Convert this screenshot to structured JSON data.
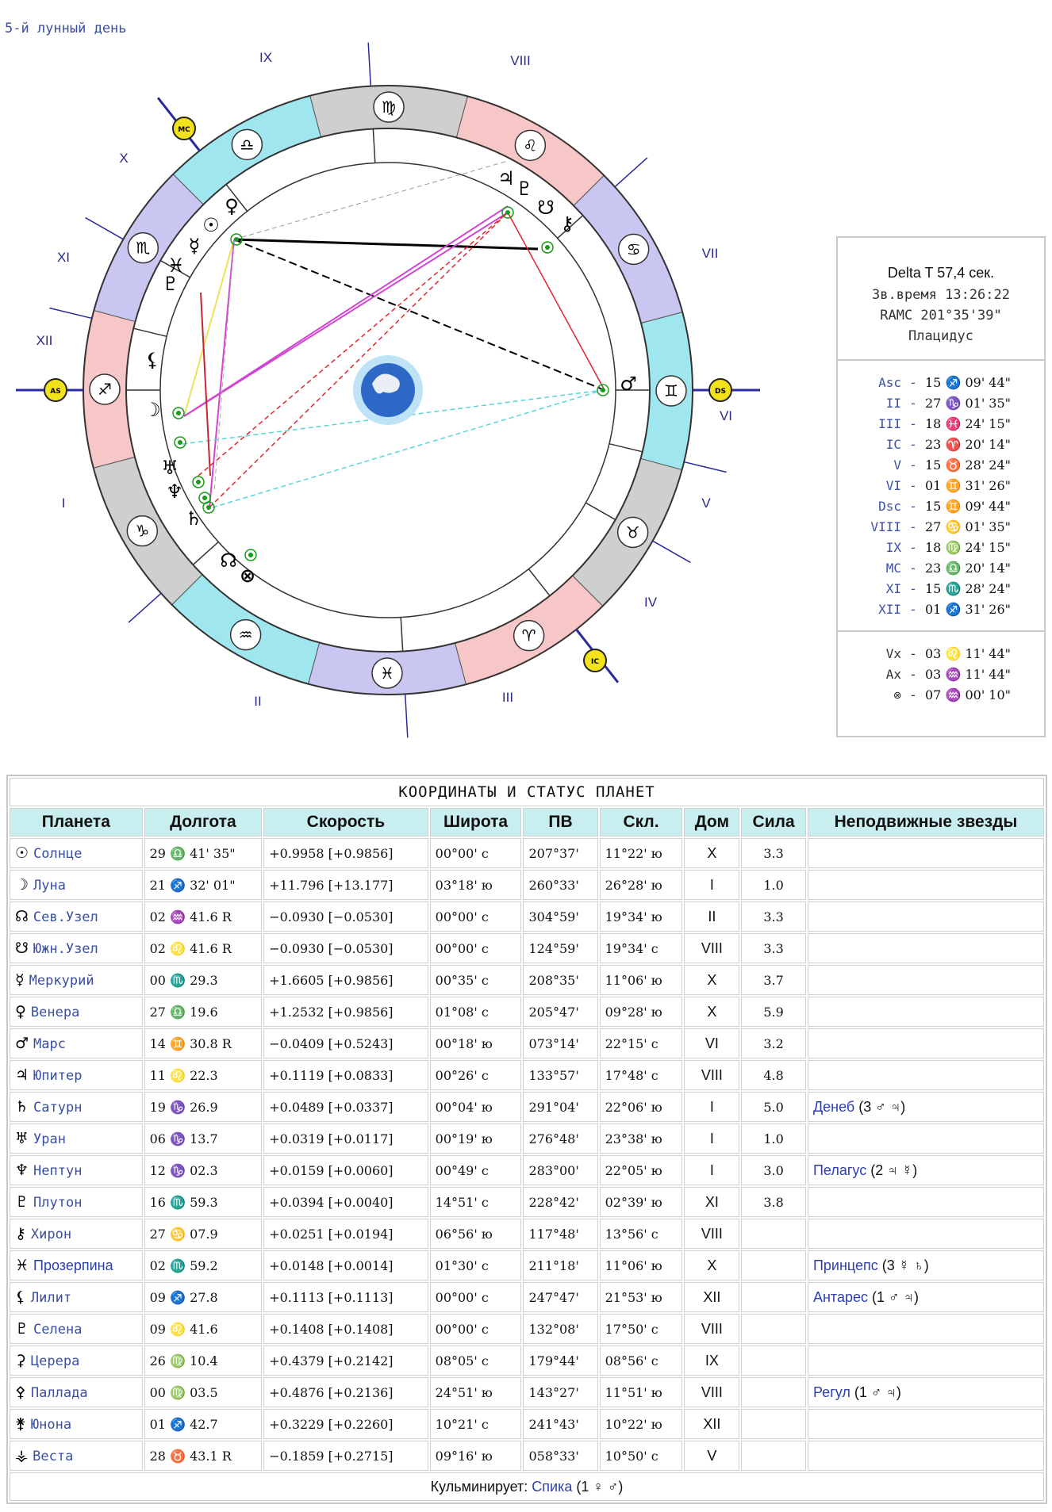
{
  "lunar_day": "5-й лунный день",
  "chart": {
    "house_numerals": [
      "I",
      "II",
      "III",
      "IV",
      "V",
      "VI",
      "VII",
      "VIII",
      "IX",
      "X",
      "XI",
      "XII"
    ],
    "angle_badges": [
      "AS",
      "DS",
      "MC",
      "IC"
    ],
    "sign_glyphs": [
      "♈",
      "♉",
      "♊",
      "♋",
      "♌",
      "♍",
      "♎",
      "♏",
      "♐",
      "♑",
      "♒",
      "♓"
    ],
    "planet_glyphs": {
      "sun": "☉",
      "moon": "☽",
      "mercury": "☿",
      "venus": "♀",
      "mars": "♂",
      "jupiter": "♃",
      "saturn": "♄",
      "uranus": "♅",
      "neptune": "♆",
      "pluto": "♇",
      "chiron": "⚷",
      "north_node": "☊",
      "south_node": "☋",
      "fortune": "⊗",
      "lilith": "⚸",
      "proserpina": "♓"
    }
  },
  "info": {
    "delta_t": "Delta T   57,4 сек.",
    "sidereal": "Зв.время 13:26:22",
    "ramc": "RAMC 201°35'39\"",
    "system": "Плацидус",
    "cusps": [
      {
        "name": "Asc",
        "value": "15 ♐ 09' 44\""
      },
      {
        "name": "II",
        "value": "27 ♑ 01' 35\""
      },
      {
        "name": "III",
        "value": "18 ♓ 24' 15\""
      },
      {
        "name": "IC",
        "value": "23 ♈ 20' 14\""
      },
      {
        "name": "V",
        "value": "15 ♉ 28' 24\""
      },
      {
        "name": "VI",
        "value": "01 ♊ 31' 26\""
      },
      {
        "name": "Dsc",
        "value": "15 ♊ 09' 44\""
      },
      {
        "name": "VIII",
        "value": "27 ♋ 01' 35\""
      },
      {
        "name": "IX",
        "value": "18 ♍ 24' 15\""
      },
      {
        "name": "MC",
        "value": "23 ♎ 20' 14\""
      },
      {
        "name": "XI",
        "value": "15 ♏ 28' 24\""
      },
      {
        "name": "XII",
        "value": "01 ♐ 31' 26\""
      }
    ],
    "extra": [
      {
        "name": "Vx",
        "value": "03 ♌ 11' 44\""
      },
      {
        "name": "Ax",
        "value": "03 ♒ 11' 44\""
      },
      {
        "name": "⊗",
        "value": "07 ♒ 00' 10\""
      }
    ]
  },
  "table": {
    "title": "КООРДИНАТЫ И СТАТУС ПЛАНЕТ",
    "headers": [
      "Планета",
      "Долгота",
      "Скорость",
      "Широта",
      "ПВ",
      "Скл.",
      "Дом",
      "Сила",
      "Неподвижные звезды"
    ],
    "rows": [
      {
        "glyph": "☉",
        "name": "Солнце",
        "lon": "29 ♎ 41' 35\"",
        "speed": "+0.9958  [+0.9856]",
        "lat": "00°00' с",
        "ra": "207°37'",
        "decl": "11°22' ю",
        "house": "X",
        "power": "3.3",
        "star": ""
      },
      {
        "glyph": "☽",
        "name": "Луна",
        "lon": "21 ♐ 32' 01\"",
        "speed": "+11.796  [+13.177]",
        "lat": "03°18' ю",
        "ra": "260°33'",
        "decl": "26°28' ю",
        "house": "I",
        "power": "1.0",
        "star": ""
      },
      {
        "glyph": "☊",
        "name": "Сев.Узел",
        "lon": "02 ♒ 41.6  R",
        "speed": "−0.0930  [−0.0530]",
        "lat": "00°00' с",
        "ra": "304°59'",
        "decl": "19°34' ю",
        "house": "II",
        "power": "3.3",
        "star": ""
      },
      {
        "glyph": "☋",
        "name": "Южн.Узел",
        "lon": "02 ♌ 41.6  R",
        "speed": "−0.0930  [−0.0530]",
        "lat": "00°00' с",
        "ra": "124°59'",
        "decl": "19°34' с",
        "house": "VIII",
        "power": "3.3",
        "star": ""
      },
      {
        "glyph": "☿",
        "name": "Меркурий",
        "lon": "00 ♏ 29.3",
        "speed": "+1.6605  [+0.9856]",
        "lat": "00°35' с",
        "ra": "208°35'",
        "decl": "11°06' ю",
        "house": "X",
        "power": "3.7",
        "star": ""
      },
      {
        "glyph": "♀",
        "name": "Венера",
        "lon": "27 ♎ 19.6",
        "speed": "+1.2532  [+0.9856]",
        "lat": "01°08' с",
        "ra": "205°47'",
        "decl": "09°28' ю",
        "house": "X",
        "power": "5.9",
        "star": ""
      },
      {
        "glyph": "♂",
        "name": "Марс",
        "lon": "14 ♊ 30.8  R",
        "speed": "−0.0409  [+0.5243]",
        "lat": "00°18' ю",
        "ra": "073°14'",
        "decl": "22°15' с",
        "house": "VI",
        "power": "3.2",
        "star": ""
      },
      {
        "glyph": "♃",
        "name": "Юпитер",
        "lon": "11 ♌ 22.3",
        "speed": "+0.1119  [+0.0833]",
        "lat": "00°26' с",
        "ra": "133°57'",
        "decl": "17°48' с",
        "house": "VIII",
        "power": "4.8",
        "star": ""
      },
      {
        "glyph": "♄",
        "name": "Сатурн",
        "lon": "19 ♑ 26.9",
        "speed": "+0.0489  [+0.0337]",
        "lat": "00°04' ю",
        "ra": "291°04'",
        "decl": "22°06' ю",
        "house": "I",
        "power": "5.0",
        "star": "Денеб",
        "star_tail": " (3 ♂ ♃)"
      },
      {
        "glyph": "♅",
        "name": "Уран",
        "lon": "06 ♑ 13.7",
        "speed": "+0.0319  [+0.0117]",
        "lat": "00°19' ю",
        "ra": "276°48'",
        "decl": "23°38' ю",
        "house": "I",
        "power": "1.0",
        "star": ""
      },
      {
        "glyph": "♆",
        "name": "Нептун",
        "lon": "12 ♑ 02.3",
        "speed": "+0.0159  [+0.0060]",
        "lat": "00°49' с",
        "ra": "283°00'",
        "decl": "22°05' ю",
        "house": "I",
        "power": "3.0",
        "star": "Пелагус",
        "star_tail": " (2 ♃ ☿)"
      },
      {
        "glyph": "♇",
        "name": "Плутон",
        "lon": "16 ♏ 59.3",
        "speed": "+0.0394  [+0.0040]",
        "lat": "14°51' с",
        "ra": "228°42'",
        "decl": "02°39' ю",
        "house": "XI",
        "power": "3.8",
        "star": ""
      },
      {
        "glyph": "⚷",
        "name": "Хирон",
        "lon": "27 ♋ 07.9",
        "speed": "+0.0251  [+0.0194]",
        "lat": "06°56' ю",
        "ra": "117°48'",
        "decl": "13°56' с",
        "house": "VIII",
        "power": "",
        "star": ""
      },
      {
        "glyph": "♓",
        "name": "Прозерпина",
        "sans": true,
        "lon": "02 ♏ 59.2",
        "speed": "+0.0148  [+0.0014]",
        "lat": "01°30' с",
        "ra": "211°18'",
        "decl": "11°06' ю",
        "house": "X",
        "power": "",
        "star": "Принцепс",
        "star_tail": " (3 ☿ ♄)"
      },
      {
        "glyph": "⚸",
        "name": "Лилит",
        "lon": "09 ♐ 27.8",
        "speed": "+0.1113  [+0.1113]",
        "lat": "00°00' с",
        "ra": "247°47'",
        "decl": "21°53' ю",
        "house": "XII",
        "power": "",
        "star": "Антарес",
        "star_tail": " (1 ♂ ♃)"
      },
      {
        "glyph": "♇",
        "name": "Селена",
        "lon": "09 ♌ 41.6",
        "speed": "+0.1408  [+0.1408]",
        "lat": "00°00' с",
        "ra": "132°08'",
        "decl": "17°50' с",
        "house": "VIII",
        "power": "",
        "star": ""
      },
      {
        "glyph": "⚳",
        "name": "Церера",
        "lon": "26 ♍ 10.4",
        "speed": "+0.4379  [+0.2142]",
        "lat": "08°05' с",
        "ra": "179°44'",
        "decl": "08°56' с",
        "house": "IX",
        "power": "",
        "star": ""
      },
      {
        "glyph": "⚴",
        "name": "Паллада",
        "lon": "00 ♍ 03.5",
        "speed": "+0.4876  [+0.2136]",
        "lat": "24°51' ю",
        "ra": "143°27'",
        "decl": "11°51' ю",
        "house": "VIII",
        "power": "",
        "star": "Регул",
        "star_tail": " (1 ♂ ♃)"
      },
      {
        "glyph": "⚵",
        "name": "Юнона",
        "lon": "01 ♐ 42.7",
        "speed": "+0.3229  [+0.2260]",
        "lat": "10°21' с",
        "ra": "241°43'",
        "decl": "10°22' ю",
        "house": "XII",
        "power": "",
        "star": ""
      },
      {
        "glyph": "⚶",
        "name": "Веста",
        "lon": "28 ♉ 43.1  R",
        "speed": "−0.1859  [+0.2715]",
        "lat": "09°16' ю",
        "ra": "058°33'",
        "decl": "10°50' с",
        "house": "V",
        "power": "",
        "star": ""
      }
    ],
    "footer_label": "Кульминирует: ",
    "footer_star": "Спика",
    "footer_tail": " (1 ♀ ♂)"
  },
  "colors": {
    "link": "#2c3fb0",
    "header_bg": "#c8eef0",
    "fire": "#f7c6c6",
    "earth": "#cfcfcf",
    "air": "#9fe6ee",
    "water": "#c9c6f2"
  }
}
